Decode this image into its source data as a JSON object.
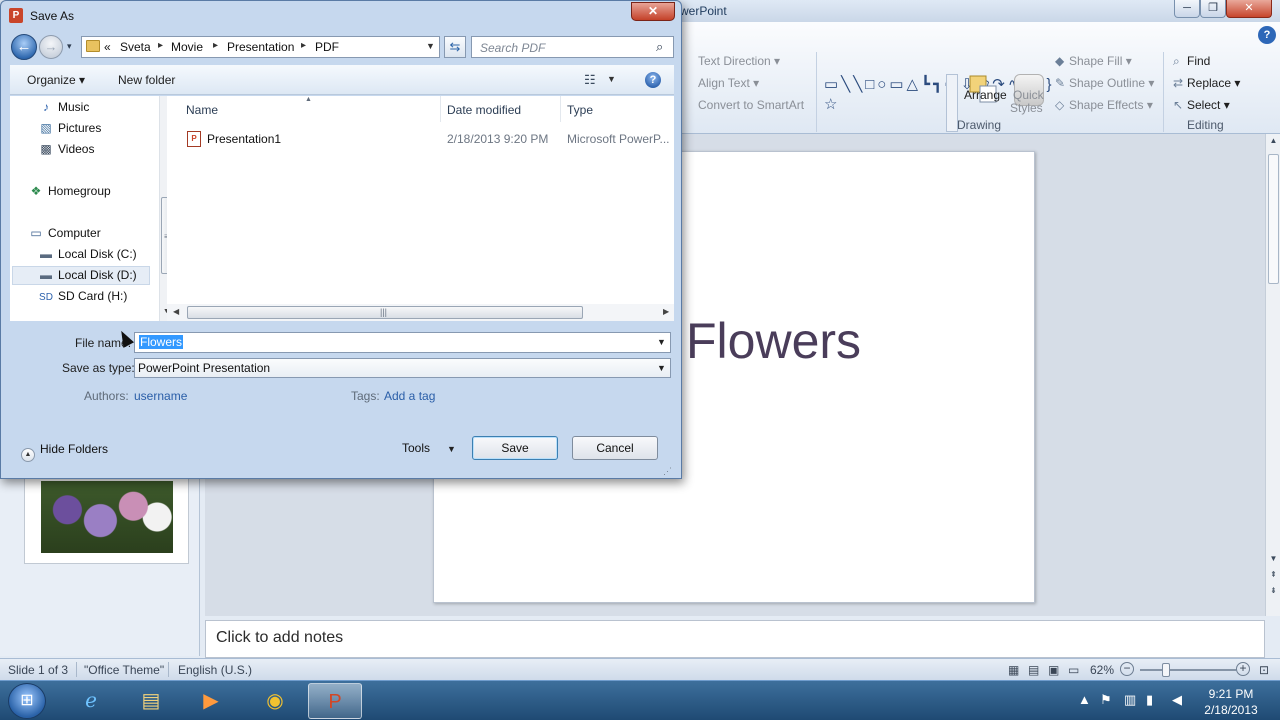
{
  "powerpoint": {
    "title_fragment": "werPoint",
    "window_controls": {
      "minimize": "─",
      "maximize": "❐",
      "close": "✕"
    },
    "help": "?",
    "ribbon": {
      "paragraph": {
        "text_direction": "Text Direction",
        "align_text": "Align Text",
        "convert_smartart": "Convert to SmartArt"
      },
      "drawing": {
        "group_label": "Drawing",
        "shapes": "▭╲╲□○▭△┗┓⇨⇩⬠↷∿⁀{}☆",
        "arrange": "Arrange",
        "quick_styles_1": "Quick",
        "quick_styles_2": "Styles",
        "shape_fill": "Shape Fill",
        "shape_outline": "Shape Outline",
        "shape_effects": "Shape Effects"
      },
      "editing": {
        "group_label": "Editing",
        "find": "Find",
        "replace": "Replace",
        "select": "Select"
      }
    },
    "slide": {
      "title": "Flowers"
    },
    "notes_placeholder": "Click to add notes",
    "status": {
      "slide_count": "Slide 1 of 3",
      "theme": "\"Office Theme\"",
      "language": "English (U.S.)",
      "zoom": "62%",
      "zoom_level": 0.62
    }
  },
  "dialog": {
    "title": "Save As",
    "close": "✕",
    "breadcrumb": [
      "Sveta",
      "Movie",
      "Presentation",
      "PDF"
    ],
    "breadcrumb_prefix": "«",
    "search_placeholder": "Search PDF",
    "toolbar": {
      "organize": "Organize",
      "new_folder": "New folder"
    },
    "nav_items": [
      {
        "label": "Music",
        "icon": "music-icon"
      },
      {
        "label": "Pictures",
        "icon": "pictures-icon"
      },
      {
        "label": "Videos",
        "icon": "videos-icon"
      },
      {
        "label": "Homegroup",
        "icon": "homegroup-icon"
      },
      {
        "label": "Computer",
        "icon": "computer-icon"
      },
      {
        "label": "Local Disk (C:)",
        "icon": "disk-icon"
      },
      {
        "label": "Local Disk (D:)",
        "icon": "disk-icon"
      },
      {
        "label": "SD Card (H:)",
        "icon": "sd-card-icon"
      }
    ],
    "columns": [
      "Name",
      "Date modified",
      "Type"
    ],
    "files": [
      {
        "name": "Presentation1",
        "date_modified": "2/18/2013 9:20 PM",
        "type": "Microsoft PowerP..."
      }
    ],
    "file_name_label": "File name:",
    "file_name_value": "Flowers",
    "save_as_type_label": "Save as type:",
    "save_as_type_value": "PowerPoint Presentation",
    "authors_label": "Authors:",
    "authors_value": "username",
    "tags_label": "Tags:",
    "tags_value": "Add a tag",
    "hide_folders": "Hide Folders",
    "tools": "Tools",
    "save": "Save",
    "cancel": "Cancel"
  },
  "taskbar": {
    "clock_time": "9:21 PM",
    "clock_date": "2/18/2013",
    "apps": [
      "internet-explorer-icon",
      "file-explorer-icon",
      "media-player-icon",
      "chrome-icon",
      "powerpoint-icon"
    ]
  }
}
